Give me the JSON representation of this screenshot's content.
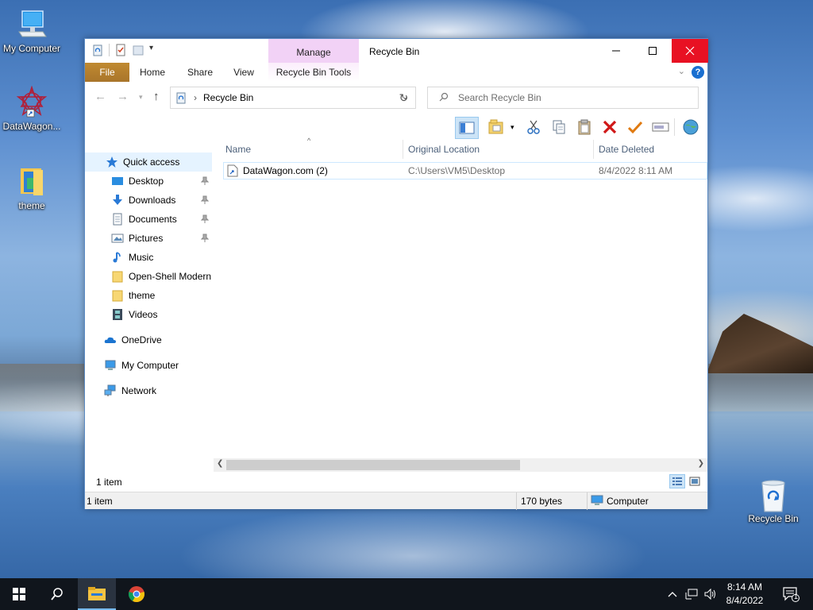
{
  "desktop": {
    "icons": [
      {
        "label": "My Computer"
      },
      {
        "label": "DataWagon..."
      },
      {
        "label": "theme"
      },
      {
        "label": "Recycle Bin"
      }
    ]
  },
  "window": {
    "title": "Recycle Bin",
    "manage_tab": "Manage",
    "ribbon_tabs": {
      "file": "File",
      "home": "Home",
      "share": "Share",
      "view": "View",
      "tools": "Recycle Bin Tools"
    },
    "address": {
      "path": "Recycle Bin"
    },
    "search": {
      "placeholder": "Search Recycle Bin"
    },
    "nav": {
      "quick_access": "Quick access",
      "items": [
        {
          "label": "Desktop"
        },
        {
          "label": "Downloads"
        },
        {
          "label": "Documents"
        },
        {
          "label": "Pictures"
        },
        {
          "label": "Music"
        },
        {
          "label": "Open-Shell Modern"
        },
        {
          "label": "theme"
        },
        {
          "label": "Videos"
        }
      ],
      "onedrive": "OneDrive",
      "my_computer": "My Computer",
      "network": "Network"
    },
    "columns": {
      "name": "Name",
      "original_location": "Original Location",
      "date_deleted": "Date Deleted"
    },
    "files": [
      {
        "name": "DataWagon.com (2)",
        "original_location": "C:\\Users\\VM5\\Desktop",
        "date_deleted": "8/4/2022 8:11 AM"
      }
    ],
    "item_count": "1 item",
    "status": {
      "items": "1 item",
      "size": "170 bytes",
      "location": "Computer"
    }
  },
  "taskbar": {
    "time": "8:14 AM",
    "date": "8/4/2022",
    "notification_count": "1"
  }
}
